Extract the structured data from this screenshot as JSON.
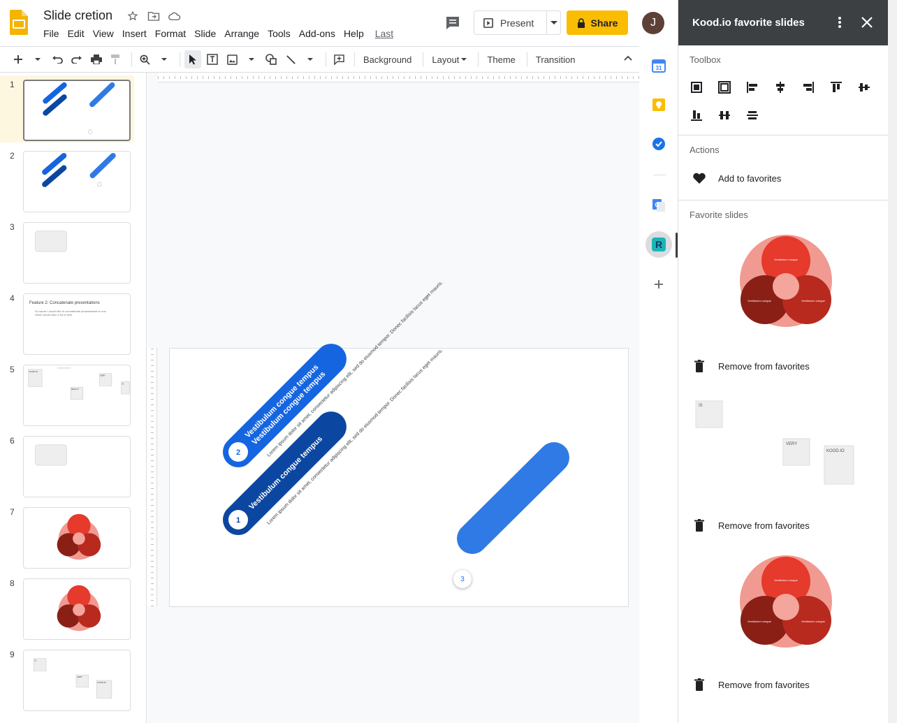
{
  "app": {
    "document_title": "Slide cretion",
    "menu": [
      "File",
      "Edit",
      "View",
      "Insert",
      "Format",
      "Slide",
      "Arrange",
      "Tools",
      "Add-ons",
      "Help"
    ],
    "last_edit_label": "Last edit was seconds ago",
    "present_label": "Present",
    "share_label": "Share",
    "user_initial": "J",
    "accent_color": "#fbbc04"
  },
  "toolbar": {
    "background_label": "Background",
    "layout_label": "Layout",
    "theme_label": "Theme",
    "transition_label": "Transition"
  },
  "filmstrip": {
    "slides": [
      {
        "number": "1",
        "kind": "diagonal"
      },
      {
        "number": "2",
        "kind": "diagonal"
      },
      {
        "number": "3",
        "kind": "blank-box"
      },
      {
        "number": "4",
        "kind": "text",
        "title": "Feature 2: Concatenate presentations",
        "subtitle": "So cause I would like to concatenate presentations is one which would save a lot of time."
      },
      {
        "number": "5",
        "kind": "boxes",
        "labels": [
          "KOOD.IO",
          "REALLY",
          "VERY",
          "IS"
        ]
      },
      {
        "number": "6",
        "kind": "blank-box"
      },
      {
        "number": "7",
        "kind": "venn"
      },
      {
        "number": "8",
        "kind": "venn"
      },
      {
        "number": "9",
        "kind": "boxes-small",
        "labels": [
          "IS",
          "VERY",
          "KOOD.IO"
        ]
      }
    ]
  },
  "slide": {
    "items": [
      {
        "number": "2",
        "heading": "Vestibulum congue tempus",
        "heading2": "Vestibulum congue tempus",
        "body": "Lorem ipsum dolor sit amet, consectetur adipiscing elit, sed do eiusmod tempor. Donec facilisis lacus eget mauris."
      },
      {
        "number": "1",
        "heading": "Vestibulum congue tempus",
        "body": "Lorem ipsum dolor sit amet, consectetur adipiscing elit, sed do eiusmod tempor. Donec facilisis lacus eget mauris."
      }
    ],
    "badge_number": "3",
    "colors": {
      "dark_blue": "#0b47a1",
      "mid_blue": "#1565e0",
      "bright_blue": "#2f7ae5"
    }
  },
  "panel": {
    "title": "Kood.io favorite slides",
    "toolbox_label": "Toolbox",
    "actions_label": "Actions",
    "add_to_favorites": "Add to favorites",
    "favorites_label": "Favorite slides",
    "remove_label": "Remove from favorites",
    "venn_labels": {
      "top": "Vestibulum congue",
      "left": "Vestibulum congue",
      "right": "Vestibulum congue"
    },
    "box_labels": {
      "is": "IS",
      "very": "VERY",
      "kood": "KOOD.IO"
    },
    "venn_colors": {
      "outer": "#f09a92",
      "top": "#e53a2c",
      "left": "#8a1f16",
      "right": "#b82a1e",
      "center": "#f4a59c"
    }
  }
}
